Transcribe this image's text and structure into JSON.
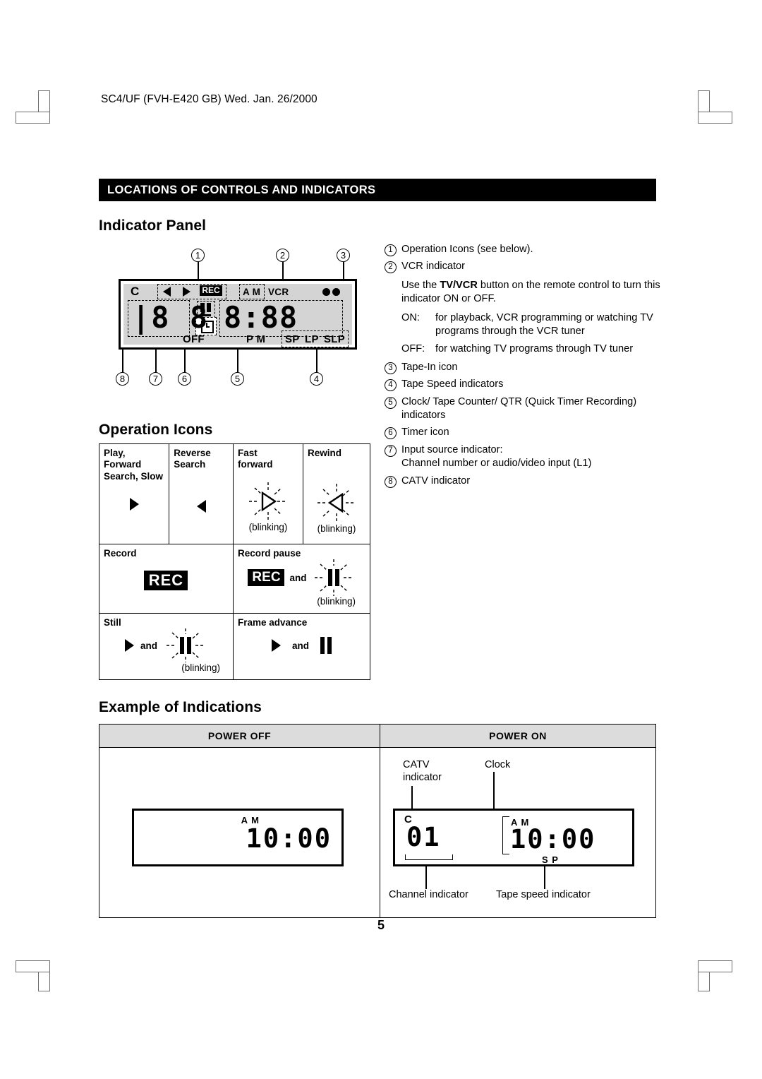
{
  "doc": {
    "header": "SC4/UF (FVH-E420 GB) Wed. Jan. 26/2000",
    "page_number": "5",
    "section_title": "LOCATIONS OF CONTROLS AND INDICATORS"
  },
  "headings": {
    "indicator_panel": "Indicator Panel",
    "operation_icons": "Operation Icons",
    "example_of_indications": "Example of Indications"
  },
  "indicator_panel": {
    "callouts_top": [
      "1",
      "2",
      "3"
    ],
    "callouts_bottom": [
      "8",
      "7",
      "6",
      "5",
      "4"
    ],
    "lcd_labels": {
      "catv": "C",
      "rec": "REC",
      "am": "A M",
      "vcr": "VCR",
      "off": "OFF",
      "pm": "P M",
      "sp": "SP",
      "lp": "LP",
      "slp": "SLP"
    }
  },
  "legend": [
    {
      "num": "1",
      "text": "Operation Icons (see below)."
    },
    {
      "num": "2",
      "text": "VCR indicator"
    },
    {
      "num": "3",
      "text": "Tape-In icon"
    },
    {
      "num": "4",
      "text": "Tape Speed indicators"
    },
    {
      "num": "5",
      "text": "Clock/ Tape Counter/ QTR (Quick Timer Recording) indicators"
    },
    {
      "num": "6",
      "text": "Timer icon"
    },
    {
      "num": "7",
      "text": "Input source indicator:"
    },
    {
      "num": "8",
      "text": "CATV indicator"
    }
  ],
  "legend_extra": {
    "vcr_use_pre": "Use the ",
    "vcr_use_bold": "TV/VCR",
    "vcr_use_post": " button on the remote control to turn this indicator ON or OFF.",
    "on_key": "ON:",
    "on_value": "for playback, VCR programming or watching TV programs through the VCR tuner",
    "off_key": "OFF:",
    "off_value": "for watching TV programs through TV tuner",
    "input_source_line2": "Channel number or audio/video input (L1)"
  },
  "operation_icons": {
    "rows": [
      [
        {
          "label": "Play,\nForward\nSearch, Slow",
          "icon": "play-triangle",
          "note": ""
        },
        {
          "label": "Reverse\nSearch",
          "icon": "reverse-triangle",
          "note": ""
        },
        {
          "label": "Fast\nforward",
          "icon": "fast-forward-blinking",
          "note": "(blinking)"
        },
        {
          "label": "Rewind",
          "icon": "rewind-blinking",
          "note": "(blinking)"
        }
      ],
      [
        {
          "label": "Record",
          "icon": "rec-badge",
          "note": ""
        },
        {
          "label": "Record pause",
          "icon": "rec-badge-and-pause-blinking",
          "note": "(blinking)",
          "and": "and"
        }
      ],
      [
        {
          "label": "Still",
          "icon": "play-and-pause-blinking",
          "note": "(blinking)",
          "and": "and"
        },
        {
          "label": "Frame advance",
          "icon": "play-and-pause",
          "note": "",
          "and": "and"
        }
      ]
    ],
    "rec_text": "REC",
    "and_text": "and",
    "blinking_text": "(blinking)"
  },
  "example": {
    "headers": [
      "POWER OFF",
      "POWER ON"
    ],
    "power_off": {
      "am": "A M",
      "time": "10:00"
    },
    "power_on": {
      "catv_caption": "CATV\nindicator",
      "catv_caption_l1": "CATV",
      "catv_caption_l2": "indicator",
      "clock_caption": "Clock",
      "catv_mark": "C",
      "channel": "01",
      "am": "A M",
      "time": "10:00",
      "speed": "S P",
      "channel_caption": "Channel indicator",
      "speed_caption": "Tape speed indicator"
    }
  }
}
